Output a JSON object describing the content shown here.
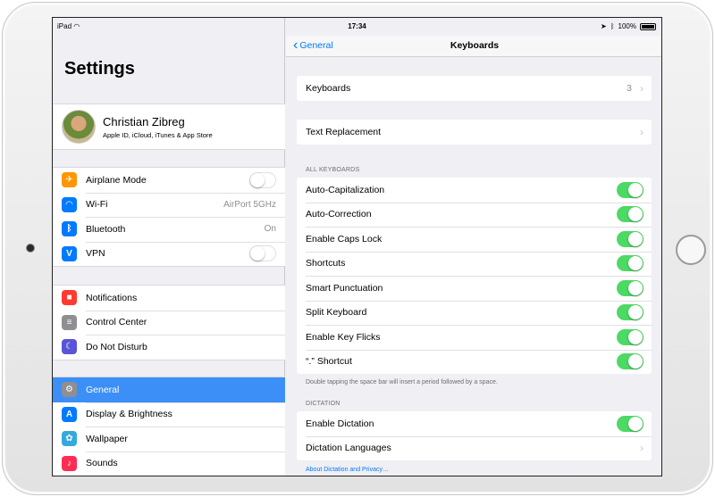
{
  "status": {
    "device": "iPad",
    "time": "17:34",
    "battery": "100%"
  },
  "left": {
    "title": "Settings",
    "profile": {
      "name": "Christian Zibreg",
      "subtitle": "Apple ID, iCloud, iTunes & App Store"
    },
    "groups": [
      [
        {
          "label": "Airplane Mode",
          "icon": "airplane-icon",
          "color": "#ff9500",
          "toggle": false
        },
        {
          "label": "Wi-Fi",
          "icon": "wifi-icon",
          "color": "#007aff",
          "value": "AirPort 5GHz"
        },
        {
          "label": "Bluetooth",
          "icon": "bluetooth-icon",
          "color": "#007aff",
          "value": "On"
        },
        {
          "label": "VPN",
          "icon": "vpn-icon",
          "color": "#007aff",
          "toggle": false
        }
      ],
      [
        {
          "label": "Notifications",
          "icon": "notifications-icon",
          "color": "#ff3b30"
        },
        {
          "label": "Control Center",
          "icon": "control-center-icon",
          "color": "#8e8e93"
        },
        {
          "label": "Do Not Disturb",
          "icon": "moon-icon",
          "color": "#5856d6"
        }
      ],
      [
        {
          "label": "General",
          "icon": "gear-icon",
          "color": "#8e8e93",
          "selected": true
        },
        {
          "label": "Display & Brightness",
          "icon": "display-icon",
          "color": "#007aff"
        },
        {
          "label": "Wallpaper",
          "icon": "wallpaper-icon",
          "color": "#34aadc"
        },
        {
          "label": "Sounds",
          "icon": "sounds-icon",
          "color": "#ff2d55"
        }
      ]
    ]
  },
  "right": {
    "nav": {
      "back_label": "General",
      "title": "Keyboards"
    },
    "keyboards_row": {
      "label": "Keyboards",
      "value": "3"
    },
    "text_replacement_row": {
      "label": "Text Replacement"
    },
    "all_keyboards_header": "ALL KEYBOARDS",
    "all_keyboards": [
      {
        "label": "Auto-Capitalization",
        "on": true
      },
      {
        "label": "Auto-Correction",
        "on": true
      },
      {
        "label": "Enable Caps Lock",
        "on": true
      },
      {
        "label": "Shortcuts",
        "on": true
      },
      {
        "label": "Smart Punctuation",
        "on": true
      },
      {
        "label": "Split Keyboard",
        "on": true
      },
      {
        "label": "Enable Key Flicks",
        "on": true
      },
      {
        "label": "“.” Shortcut",
        "on": true
      }
    ],
    "period_footnote": "Double tapping the space bar will insert a period followed by a space.",
    "dictation_header": "DICTATION",
    "dictation": {
      "enable_label": "Enable Dictation",
      "enable_on": true,
      "languages_label": "Dictation Languages"
    },
    "about_link": "About Dictation and Privacy…"
  }
}
